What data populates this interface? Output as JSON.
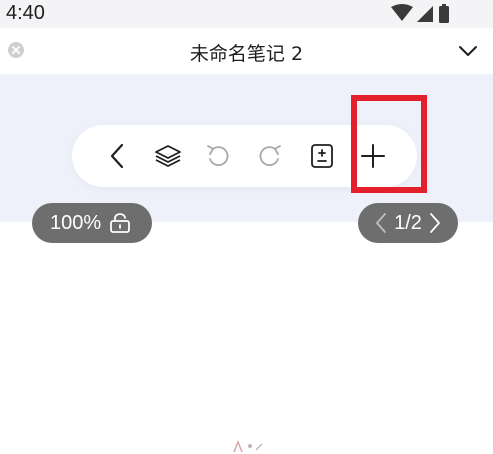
{
  "status_bar": {
    "time": "4:40",
    "icons": [
      "wifi-icon",
      "signal-icon",
      "battery-icon"
    ]
  },
  "title_bar": {
    "title": "未命名笔记 2",
    "close_icon": "close-icon",
    "expand_icon": "chevron-down-icon"
  },
  "toolbar": {
    "buttons": [
      "back-icon",
      "layers-icon",
      "undo-icon",
      "redo-icon",
      "add-page-icon",
      "plus-icon"
    ]
  },
  "zoom": {
    "value": "100%",
    "lock_icon": "unlock-icon"
  },
  "pagination": {
    "current": "1/2"
  },
  "colors": {
    "canvas_band": "#eef0fa",
    "pill": "#6e6e6e",
    "highlight": "#e3202b"
  }
}
